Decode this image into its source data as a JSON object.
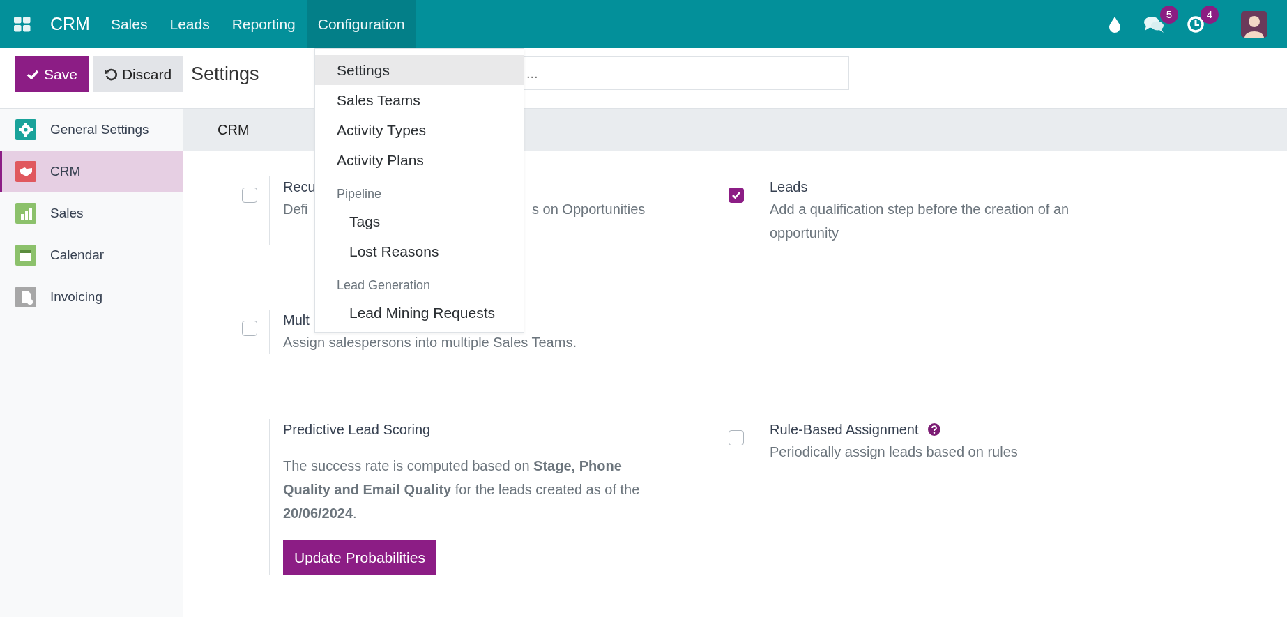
{
  "navbar": {
    "app_name": "CRM",
    "menu": [
      {
        "label": "Sales",
        "selected": false
      },
      {
        "label": "Leads",
        "selected": false
      },
      {
        "label": "Reporting",
        "selected": false
      },
      {
        "label": "Configuration",
        "selected": true
      }
    ],
    "messages_badge": "5",
    "activities_badge": "4"
  },
  "control_panel": {
    "save": "Save",
    "discard": "Discard",
    "title": "Settings",
    "search_placeholder": "..."
  },
  "sidebar": {
    "items": [
      {
        "label": "General Settings",
        "selected": false,
        "color": "#1aa39a"
      },
      {
        "label": "CRM",
        "selected": true,
        "color": "#e0585e"
      },
      {
        "label": "Sales",
        "selected": false,
        "color": "#8cc16b"
      },
      {
        "label": "Calendar",
        "selected": false,
        "color": "#8cc16b"
      },
      {
        "label": "Invoicing",
        "selected": false,
        "color": "#a7a7a7"
      }
    ]
  },
  "section": {
    "title": "CRM"
  },
  "settings_rows": [
    [
      {
        "kind": "checkbox",
        "title": "Recu",
        "checked": false,
        "description_fragments": [
          "Defi",
          "s on Opportunities"
        ]
      },
      {
        "kind": "checkbox",
        "title": "Leads",
        "checked": true,
        "description": "Add a qualification step before the creation of an opportunity"
      }
    ],
    [
      {
        "kind": "checkbox",
        "title": "Mult",
        "checked": false,
        "description": "Assign salespersons into multiple Sales Teams."
      }
    ],
    [
      {
        "kind": "plain",
        "title": "Predictive Lead Scoring",
        "description": "The success rate is computed based on **Stage, Phone Quality and Email Quality** for the leads created as of the **20/06/2024**.",
        "button": "Update Probabilities"
      },
      {
        "kind": "checkbox",
        "title": "Rule-Based Assignment",
        "checked": false,
        "help": true,
        "description": "Periodically assign leads based on rules"
      }
    ]
  ],
  "dropdown": {
    "items": [
      {
        "kind": "item",
        "label": "Settings",
        "selected": true
      },
      {
        "kind": "item",
        "label": "Sales Teams",
        "selected": false
      },
      {
        "kind": "item",
        "label": "Activity Types",
        "selected": false
      },
      {
        "kind": "item",
        "label": "Activity Plans",
        "selected": false
      },
      {
        "kind": "header",
        "label": "Pipeline",
        "selected": false
      },
      {
        "kind": "subitem",
        "label": "Tags",
        "selected": false
      },
      {
        "kind": "subitem",
        "label": "Lost Reasons",
        "selected": false
      },
      {
        "kind": "header",
        "label": "Lead Generation",
        "selected": false
      },
      {
        "kind": "subitem",
        "label": "Lead Mining Requests",
        "selected": false
      }
    ]
  }
}
